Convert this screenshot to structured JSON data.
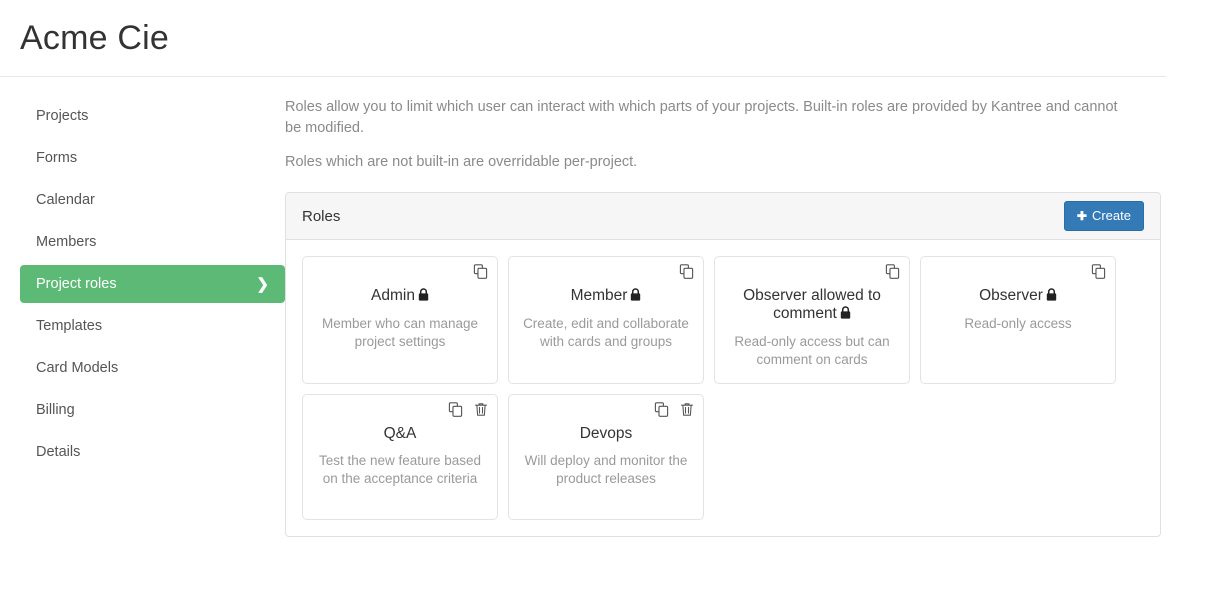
{
  "header": {
    "title": "Acme Cie"
  },
  "sidebar": {
    "items": [
      {
        "label": "Projects",
        "active": false
      },
      {
        "label": "Forms",
        "active": false
      },
      {
        "label": "Calendar",
        "active": false
      },
      {
        "label": "Members",
        "active": false
      },
      {
        "label": "Project roles",
        "active": true
      },
      {
        "label": "Templates",
        "active": false
      },
      {
        "label": "Card Models",
        "active": false
      },
      {
        "label": "Billing",
        "active": false
      },
      {
        "label": "Details",
        "active": false
      }
    ],
    "active_chevron": "❯",
    "active_color": "#5cb976"
  },
  "main": {
    "intro_line_1": "Roles allow you to limit which user can interact with which parts of your projects. Built-in roles are provided by Kantree and cannot be modified.",
    "intro_line_2": "Roles which are not built-in are overridable per-project.",
    "panel": {
      "title": "Roles",
      "create_label": "Create",
      "create_plus": "✚",
      "create_color": "#337ab7"
    },
    "roles": [
      {
        "name": "Admin",
        "description": "Member who can manage project settings",
        "builtin": true,
        "lock_icon": "lock-icon",
        "actions": [
          "copy-icon"
        ]
      },
      {
        "name": "Member",
        "description": "Create, edit and collaborate with cards and groups",
        "builtin": true,
        "lock_icon": "lock-icon",
        "actions": [
          "copy-icon"
        ]
      },
      {
        "name": "Observer allowed to comment",
        "description": "Read-only access but can comment on cards",
        "builtin": true,
        "lock_icon": "lock-icon",
        "actions": [
          "copy-icon"
        ]
      },
      {
        "name": "Observer",
        "description": "Read-only access",
        "builtin": true,
        "lock_icon": "lock-icon",
        "actions": [
          "copy-icon"
        ]
      },
      {
        "name": "Q&A",
        "description": "Test the new feature based on the acceptance criteria",
        "builtin": false,
        "lock_icon": "",
        "actions": [
          "copy-icon",
          "trash-icon"
        ]
      },
      {
        "name": "Devops",
        "description": "Will deploy and monitor the product releases",
        "builtin": false,
        "lock_icon": "",
        "actions": [
          "copy-icon",
          "trash-icon"
        ]
      }
    ]
  }
}
